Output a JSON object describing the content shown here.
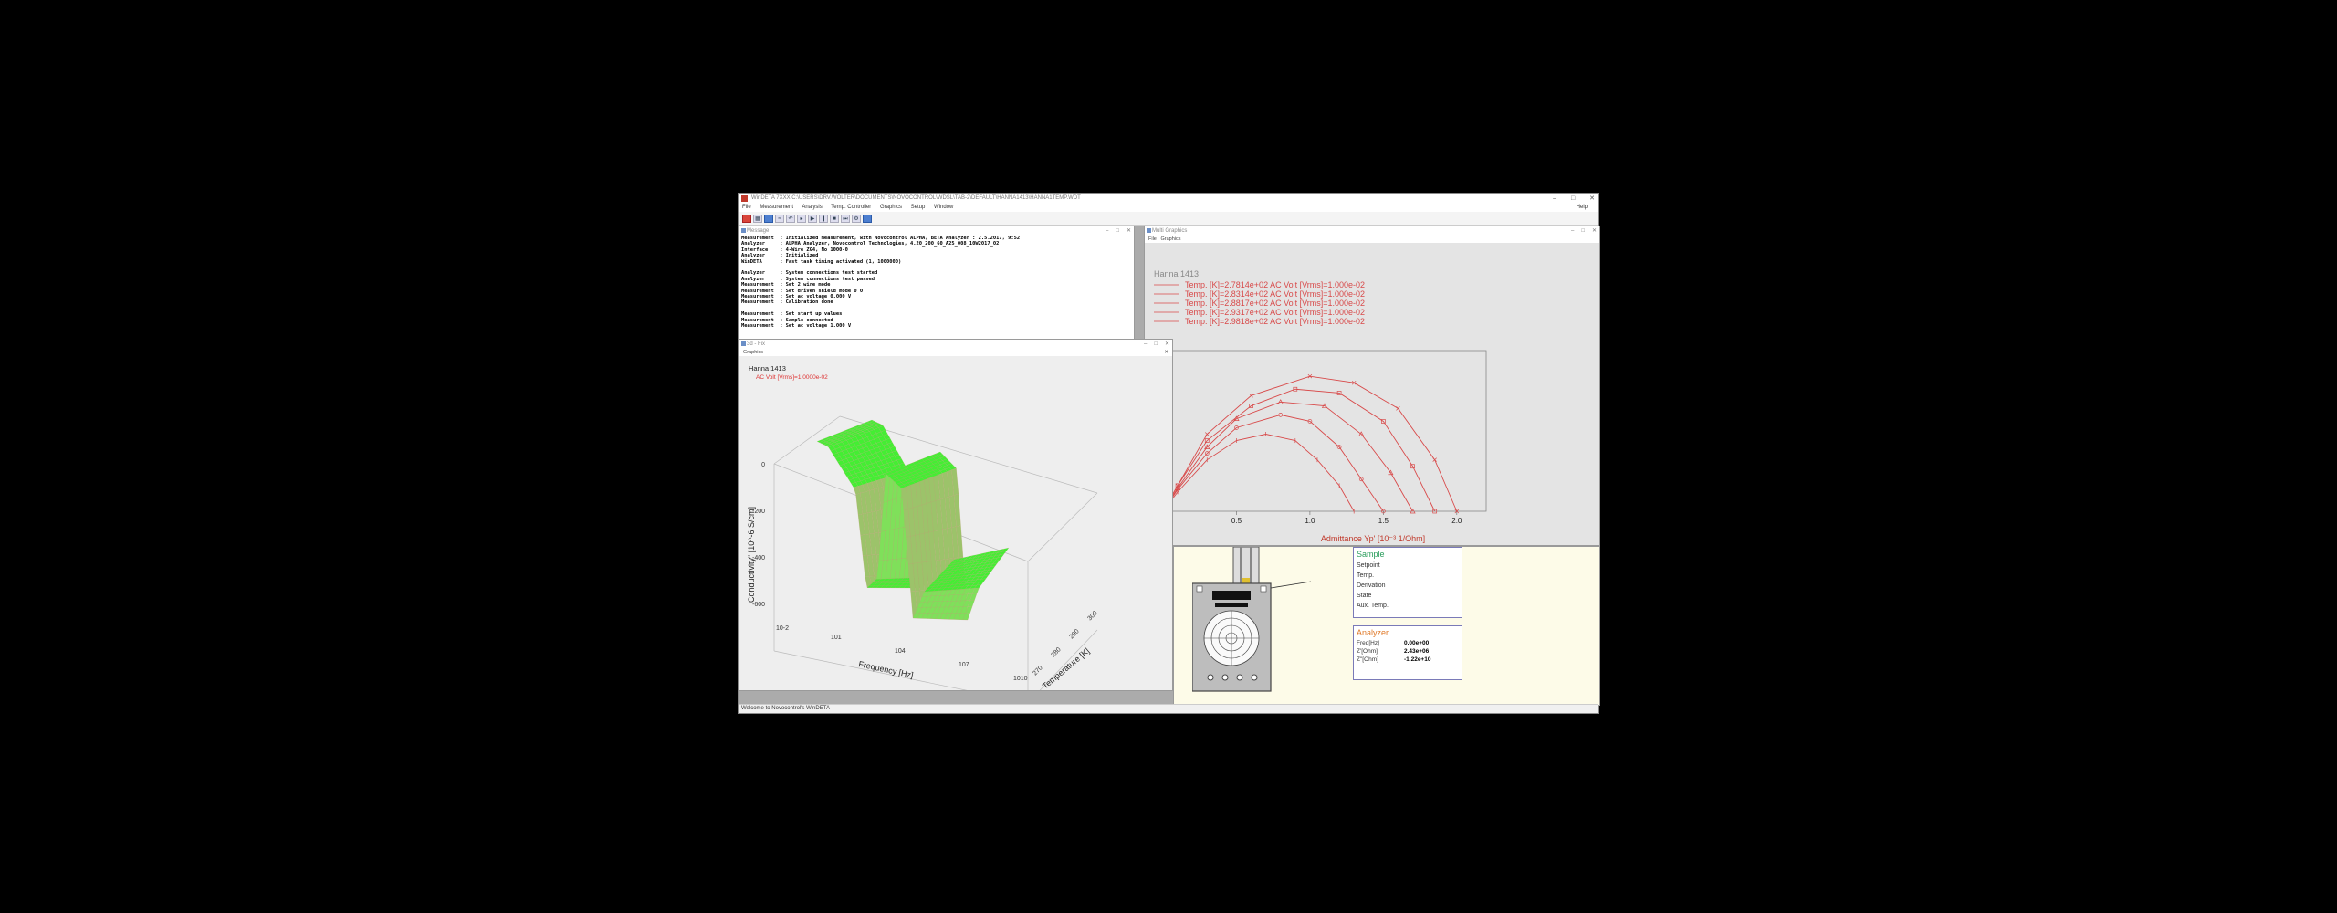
{
  "app": {
    "title": "WinDETA 7XXX  C:\\USERS\\DRV.WOLTER\\DOCUMENTS\\NOVOCONTROL\\WDSL\\TAB-2\\DEFAULT\\HANNA1413\\HANNA1TEMP.WDT",
    "menu": [
      "File",
      "Measurement",
      "Analysis",
      "Temp. Controller",
      "Graphics",
      "Setup",
      "Window"
    ],
    "help": "Help",
    "status": "Welcome to Novocontrol's WinDETA"
  },
  "message_window": {
    "title": "Message",
    "lines": [
      "Measurement  : Initialized measurement, with Novocontrol ALPHA, BETA Analyzer : 2.5.2017, 9:52",
      "Analyzer     : ALPHA Analyzer, Novocontrol Technologies, 4.20_200_60_A25_008_10W2017_02",
      "Interface    : 4-Wire ZG4, No 1000-0",
      "Analyzer     : Initialized",
      "WinDETA      : Fast task timing activated (1, 1000000)",
      "",
      "Analyzer     : System connections test started",
      "Analyzer     : System connections test passed",
      "Measurement  : Set 2 wire mode",
      "Measurement  : Set driven shield mode 0 0",
      "Measurement  : Set ac voltage 0.000 V",
      "Measurement  : Calibration done",
      "",
      "Measurement  : Set start up values",
      "Measurement  : Sample connected",
      "Measurement  : Set ac voltage 1.000 V"
    ]
  },
  "graphics3d_window": {
    "title": "3d - Fix",
    "menu": "Graphics",
    "sample": "Hanna 1413",
    "param": "AC Volt  [Vrms]=1.0000e-02",
    "zlabel": "Conductivity\" [10^-6 S/cm]",
    "xlabel": "Frequency [Hz]",
    "ylabel": "Temperature [K]",
    "zticks": [
      "0",
      "-200",
      "-400",
      "-600"
    ],
    "xticks": [
      "10-2",
      "101",
      "104",
      "107",
      "1010"
    ],
    "yticks": [
      "270",
      "280",
      "290",
      "300"
    ]
  },
  "multi_graphics": {
    "title": "Multi Graphics",
    "menu": [
      "File",
      "Graphics"
    ],
    "sample": "Hanna 1413",
    "legend": [
      "Temp. [K]=2.7814e+02    AC Volt  [Vrms]=1.000e-02",
      "Temp. [K]=2.8314e+02    AC Volt  [Vrms]=1.000e-02",
      "Temp. [K]=2.8817e+02    AC Volt  [Vrms]=1.000e-02",
      "Temp. [K]=2.9317e+02    AC Volt  [Vrms]=1.000e-02",
      "Temp. [K]=2.9818e+02    AC Volt  [Vrms]=1.000e-02"
    ],
    "xlabel": "Admittance Yp' [10⁻³ 1/Ohm]",
    "xticks": [
      "0.0",
      "0.5",
      "1.0",
      "1.5",
      "2.0"
    ],
    "series_color": "#d84a4a"
  },
  "chart_data": {
    "type": "line",
    "xlabel": "Admittance Yp' [10-3 1/Ohm]",
    "xlim": [
      0,
      2.2
    ],
    "series": [
      {
        "name": "Temp. [K]=2.7814e+02",
        "x": [
          0.0,
          0.1,
          0.3,
          0.5,
          0.7,
          0.9,
          1.05,
          1.2,
          1.3
        ],
        "y": [
          0.0,
          0.15,
          0.4,
          0.55,
          0.6,
          0.55,
          0.4,
          0.2,
          0.0
        ]
      },
      {
        "name": "Temp. [K]=2.8314e+02",
        "x": [
          0.0,
          0.1,
          0.3,
          0.5,
          0.8,
          1.0,
          1.2,
          1.35,
          1.5
        ],
        "y": [
          0.0,
          0.17,
          0.45,
          0.65,
          0.75,
          0.7,
          0.5,
          0.25,
          0.0
        ]
      },
      {
        "name": "Temp. [K]=2.8817e+02",
        "x": [
          0.0,
          0.1,
          0.3,
          0.5,
          0.8,
          1.1,
          1.35,
          1.55,
          1.7
        ],
        "y": [
          0.0,
          0.18,
          0.5,
          0.72,
          0.85,
          0.82,
          0.6,
          0.3,
          0.0
        ]
      },
      {
        "name": "Temp. [K]=2.9317e+02",
        "x": [
          0.0,
          0.1,
          0.3,
          0.6,
          0.9,
          1.2,
          1.5,
          1.7,
          1.85
        ],
        "y": [
          0.0,
          0.2,
          0.55,
          0.82,
          0.95,
          0.92,
          0.7,
          0.35,
          0.0
        ]
      },
      {
        "name": "Temp. [K]=2.9818e+02",
        "x": [
          0.0,
          0.1,
          0.3,
          0.6,
          1.0,
          1.3,
          1.6,
          1.85,
          2.0
        ],
        "y": [
          0.0,
          0.2,
          0.6,
          0.9,
          1.05,
          1.0,
          0.8,
          0.4,
          0.0
        ]
      }
    ]
  },
  "sample_panel": {
    "sample_title": "Sample",
    "sample_rows": [
      "Setpoint",
      "Temp.",
      "Derivation",
      "State",
      "Aux. Temp."
    ],
    "analyzer_title": "Analyzer",
    "analyzer_rows": [
      {
        "k": "Freq[Hz]",
        "v": "0.00e+00"
      },
      {
        "k": "Z'[Ohm]",
        "v": "2.43e+06"
      },
      {
        "k": "Z\"[Ohm]",
        "v": "-1.22e+10"
      }
    ]
  }
}
